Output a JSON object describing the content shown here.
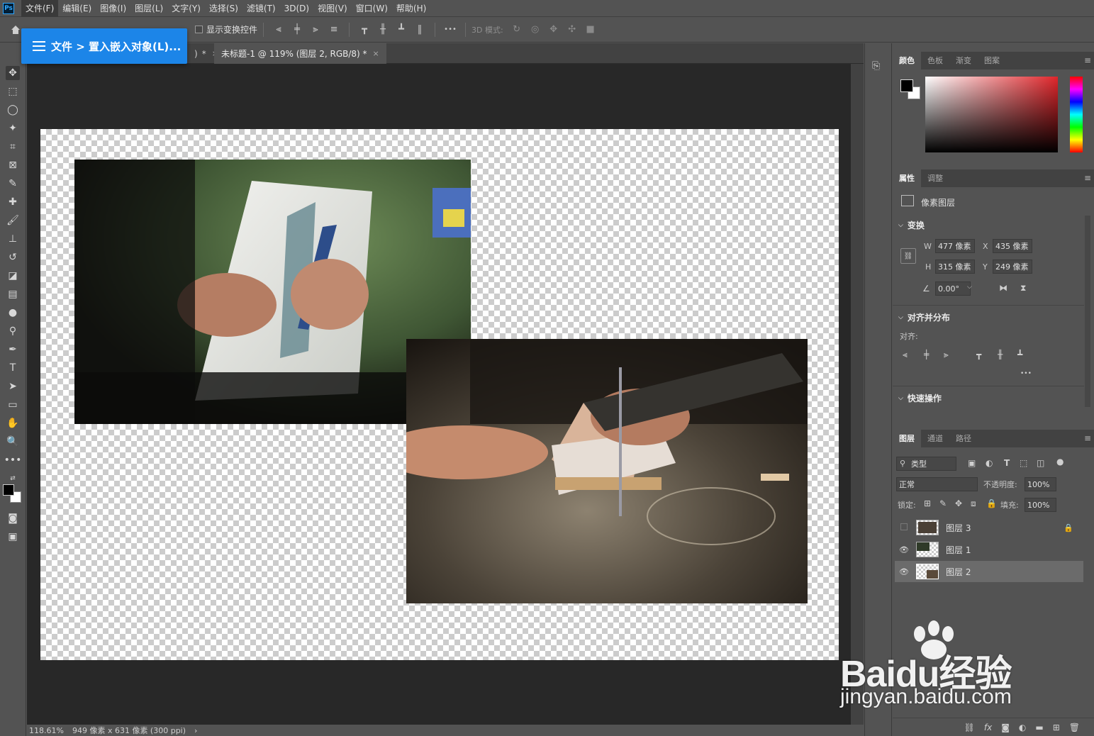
{
  "app": {
    "logo": "Ps"
  },
  "menu": [
    "文件(F)",
    "编辑(E)",
    "图像(I)",
    "图层(L)",
    "文字(Y)",
    "选择(S)",
    "滤镜(T)",
    "3D(D)",
    "视图(V)",
    "窗口(W)",
    "帮助(H)"
  ],
  "options": {
    "show_transform_label": "显示变换控件",
    "more": "•••",
    "mode_3d_label": "3D 模式:"
  },
  "popup": {
    "text": "文件 > 置入嵌入对象(L)..."
  },
  "tabs": [
    {
      "label": ")",
      "suffix": "*",
      "close": "×"
    },
    {
      "label": "未标题-1 @ 119% (图层 2, RGB/8) *",
      "close": "×"
    }
  ],
  "status": {
    "zoom": "118.61%",
    "doc_info": "949 像素 x 631 像素 (300 ppi)",
    "arrow": "›"
  },
  "color_panel": {
    "tabs": [
      "颜色",
      "色板",
      "渐变",
      "图案"
    ],
    "foreground": "#000000",
    "background": "#ffffff",
    "hue_color": "#e0262b"
  },
  "properties_panel": {
    "tabs": [
      "属性",
      "调整"
    ],
    "layer_type": "像素图层",
    "transform_title": "变换",
    "w_label": "W",
    "w_value": "477 像素",
    "h_label": "H",
    "h_value": "315 像素",
    "x_label": "X",
    "x_value": "435 像素",
    "y_label": "Y",
    "y_value": "249 像素",
    "angle_value": "0.00°",
    "align_title": "对齐并分布",
    "align_label": "对齐:",
    "align_more": "•••",
    "quick_title": "快速操作"
  },
  "layers_panel": {
    "tabs": [
      "图层",
      "通道",
      "路径"
    ],
    "filter_kind": "类型",
    "blend_mode": "正常",
    "opacity_label": "不透明度:",
    "opacity_value": "100%",
    "lock_label": "锁定:",
    "fill_label": "填充:",
    "fill_value": "100%",
    "layers": [
      {
        "name": "图层 3",
        "visible": false,
        "locked": true,
        "selected": false
      },
      {
        "name": "图层 1",
        "visible": true,
        "locked": false,
        "selected": false
      },
      {
        "name": "图层 2",
        "visible": true,
        "locked": false,
        "selected": true
      }
    ],
    "footer_fx": "fx"
  },
  "watermark": {
    "brand": "Baidu经验",
    "url": "jingyan.baidu.com"
  }
}
